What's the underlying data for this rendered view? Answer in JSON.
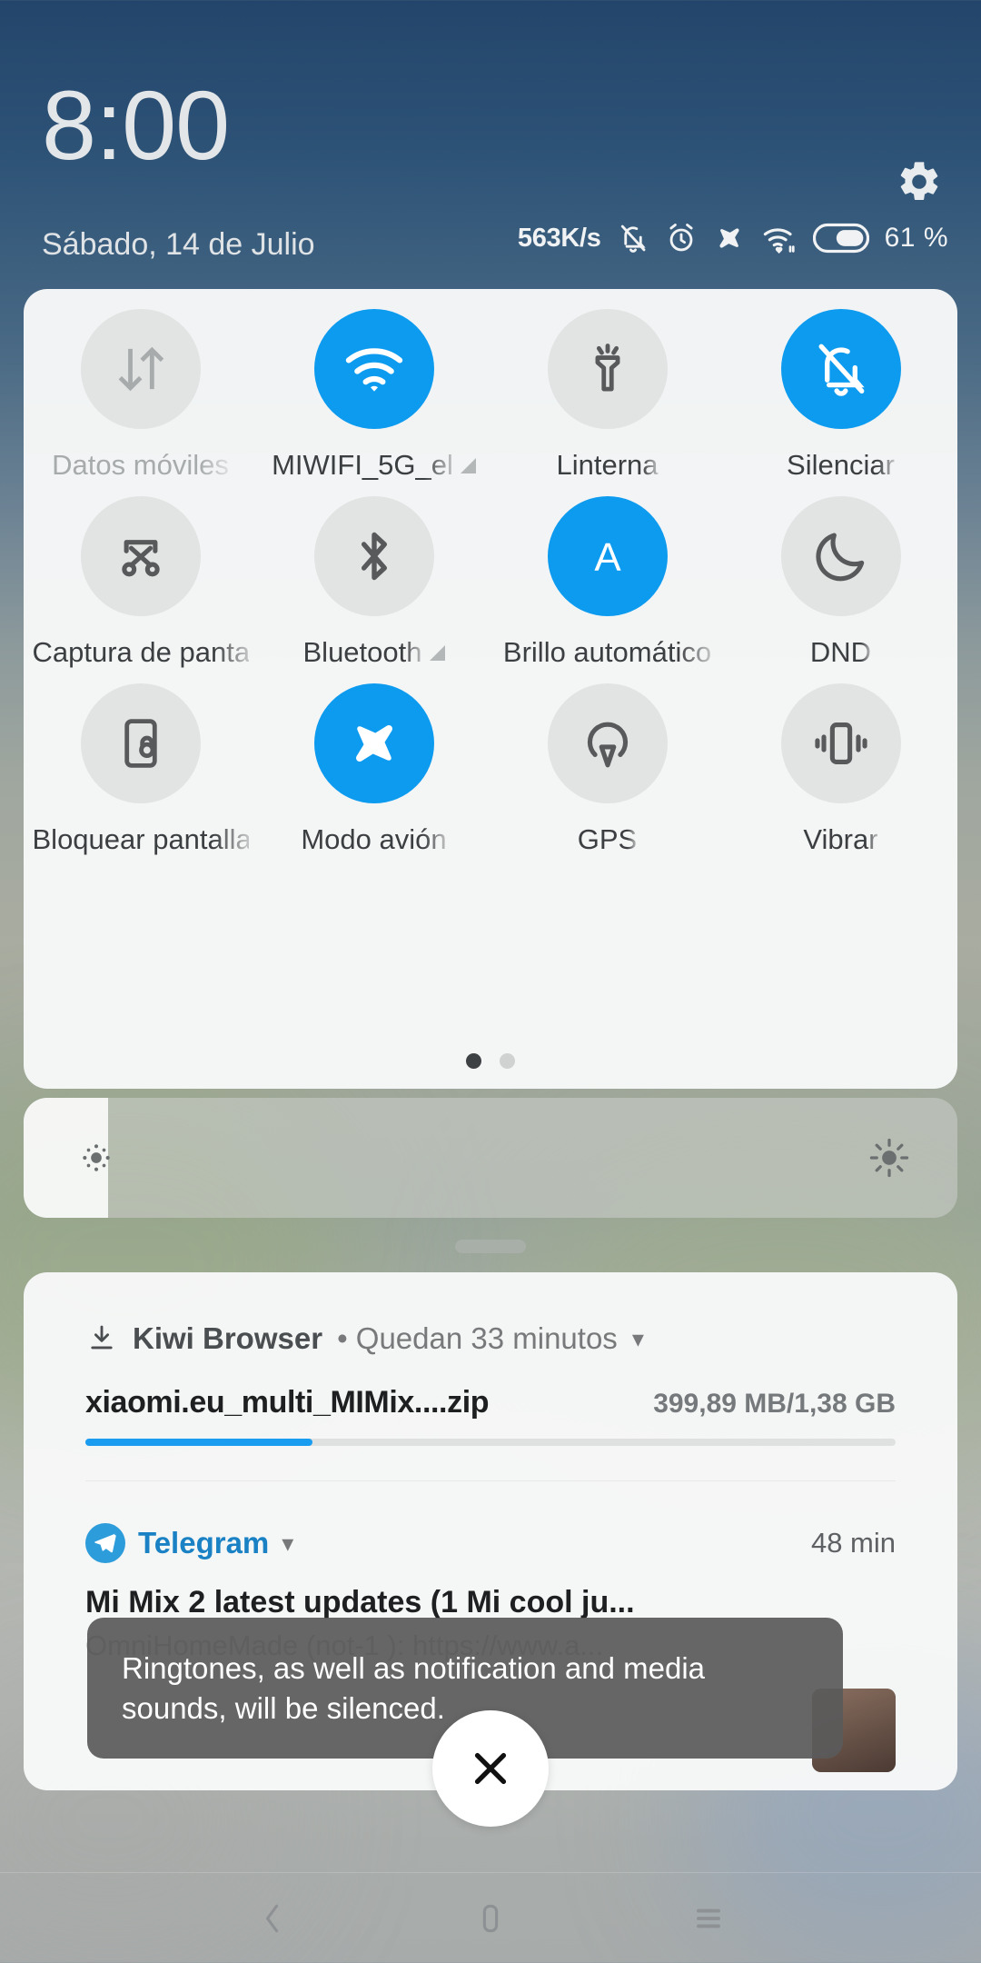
{
  "statusbar": {
    "clock": "8:00",
    "date": "Sábado, 14 de Julio",
    "network_speed": "563K/s",
    "battery_percent": "61 %",
    "icons": [
      "silent-bell-icon",
      "alarm-icon",
      "airplane-icon",
      "wifi-icon",
      "battery-icon"
    ],
    "settings_icon": "gear-icon"
  },
  "quick_settings": {
    "tiles": [
      {
        "label": "Datos móviles",
        "icon": "mobile-data-icon",
        "active": false,
        "disabled": true,
        "expandable": false
      },
      {
        "label": "MIWIFI_5G_el",
        "icon": "wifi-icon",
        "active": true,
        "disabled": false,
        "expandable": true
      },
      {
        "label": "Linterna",
        "icon": "flashlight-icon",
        "active": false,
        "disabled": false,
        "expandable": false
      },
      {
        "label": "Silenciar",
        "icon": "silent-bell-icon",
        "active": true,
        "disabled": false,
        "expandable": false
      },
      {
        "label": "Captura de panta",
        "icon": "screenshot-icon",
        "active": false,
        "disabled": false,
        "expandable": false
      },
      {
        "label": "Bluetooth",
        "icon": "bluetooth-icon",
        "active": false,
        "disabled": false,
        "expandable": true
      },
      {
        "label": "Brillo automático",
        "icon": "auto-brightness-icon",
        "active": true,
        "disabled": false,
        "expandable": false
      },
      {
        "label": "DND",
        "icon": "moon-icon",
        "active": false,
        "disabled": false,
        "expandable": false
      },
      {
        "label": "Bloquear pantalla",
        "icon": "screen-lock-icon",
        "active": false,
        "disabled": false,
        "expandable": false
      },
      {
        "label": "Modo avión",
        "icon": "airplane-icon",
        "active": true,
        "disabled": false,
        "expandable": false
      },
      {
        "label": "GPS",
        "icon": "gps-icon",
        "active": false,
        "disabled": false,
        "expandable": false
      },
      {
        "label": "Vibrar",
        "icon": "vibrate-icon",
        "active": false,
        "disabled": false,
        "expandable": false
      }
    ],
    "page_count": 2,
    "page_active": 1,
    "accent_color": "#0d9bf0"
  },
  "brightness": {
    "value_percent": 9,
    "low_icon": "brightness-low-icon",
    "high_icon": "brightness-high-icon"
  },
  "notifications": [
    {
      "app": "Kiwi Browser",
      "subtitle": "• Quedan 33 minutos",
      "icon": "download-icon",
      "title": "xiaomi.eu_multi_MIMix....zip",
      "size": "399,89 MB/1,38 GB",
      "progress_percent": 28
    },
    {
      "app": "Telegram",
      "time": "48 min",
      "icon": "telegram-icon",
      "title": "Mi Mix 2 latest updates (1 Mi cool ju...",
      "body": "OmniHomeMade (not-1          ): https://www.a..."
    }
  ],
  "toast": {
    "message": "Ringtones, as well as notification and media sounds, will be silenced."
  },
  "close_button": {
    "icon": "close-icon"
  },
  "navbar": {
    "buttons": [
      {
        "icon": "back-icon"
      },
      {
        "icon": "home-icon"
      },
      {
        "icon": "recents-icon"
      }
    ]
  }
}
